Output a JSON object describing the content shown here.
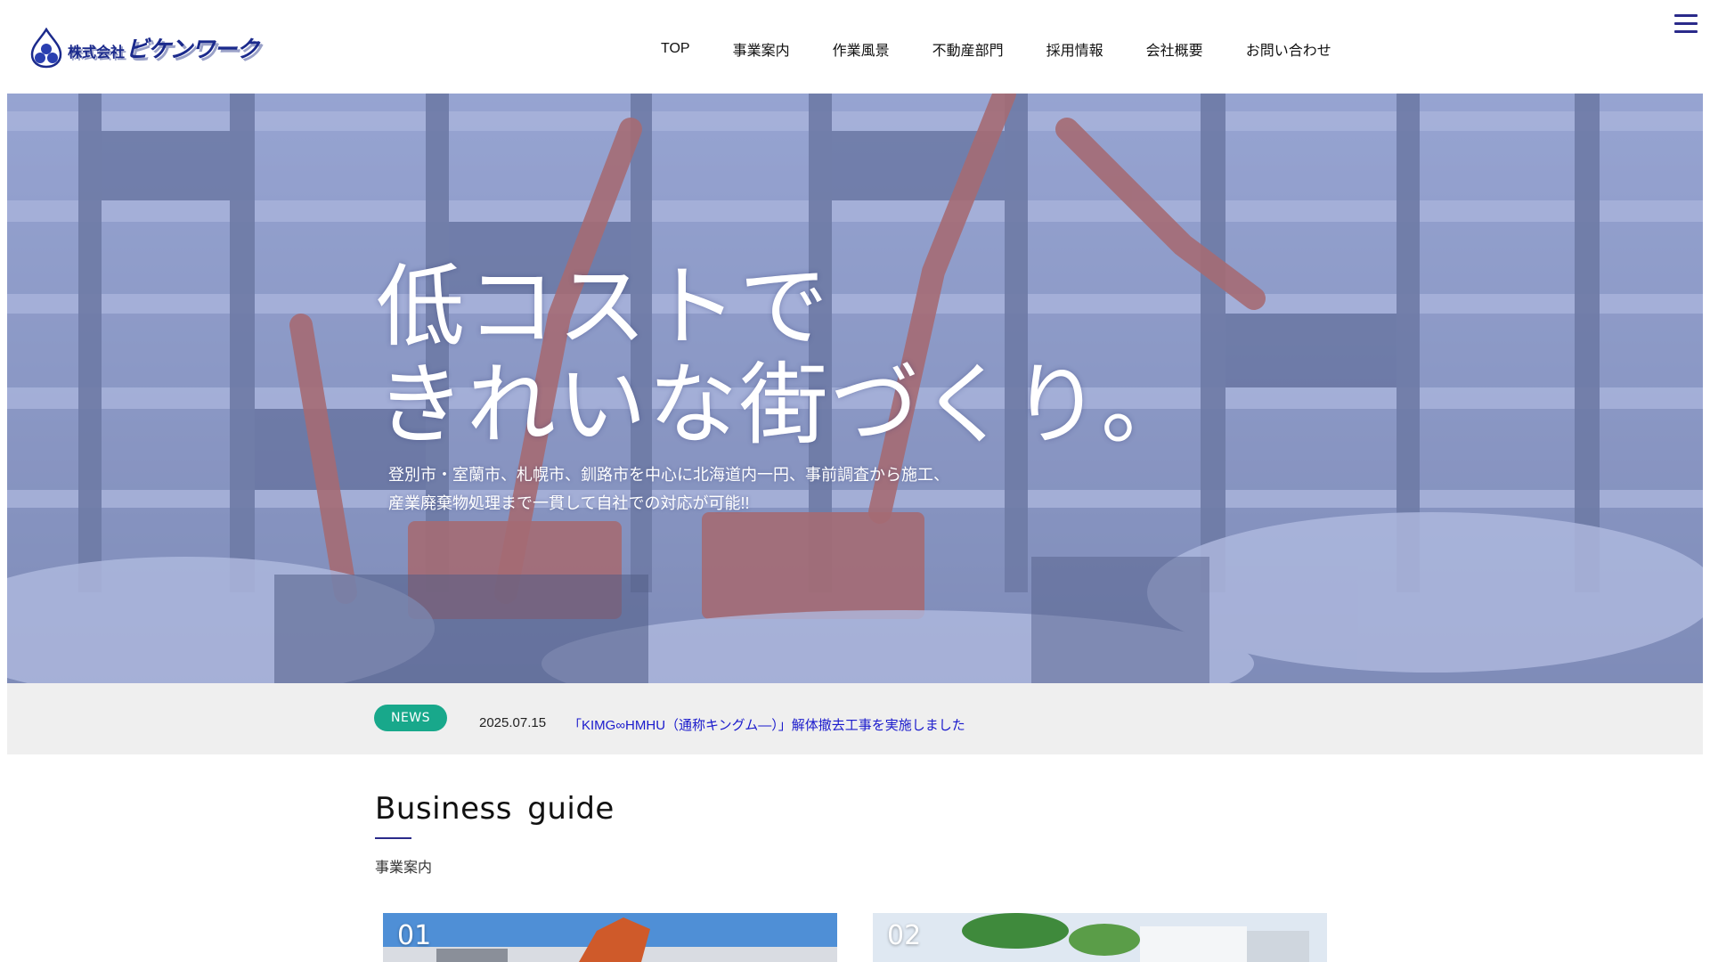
{
  "header": {
    "logo_prefix": "株式会社",
    "logo_name": "ビケンワーク",
    "nav": [
      {
        "label": "TOP"
      },
      {
        "label": "事業案内"
      },
      {
        "label": "作業風景"
      },
      {
        "label": "不動産部門"
      },
      {
        "label": "採用情報"
      },
      {
        "label": "会社概要"
      },
      {
        "label": "お問い合わせ"
      }
    ]
  },
  "hero": {
    "title_line1": "低コストで",
    "title_line2": "きれいな街づくり。",
    "subtitle_line1": "登別市・室蘭市、札幌市、釧路市を中心に北海道内一円、事前調査から施工、",
    "subtitle_line2": "産業廃棄物処理まで一貫して自社での対応が可能!!"
  },
  "news": {
    "badge": "NEWS",
    "date": "2025.07.15",
    "headline": "「KIMG∞HMHU（通称キングム―）」解体撤去工事を実施しました"
  },
  "business": {
    "title": "Business  guide",
    "subtitle": "事業案内",
    "cards": [
      {
        "number": "01"
      },
      {
        "number": "02"
      }
    ]
  },
  "colors": {
    "brand": "#1b2a8c",
    "news_badge": "#18a88b",
    "link": "#1a1acc",
    "hero_tint": "#6c80cd"
  }
}
